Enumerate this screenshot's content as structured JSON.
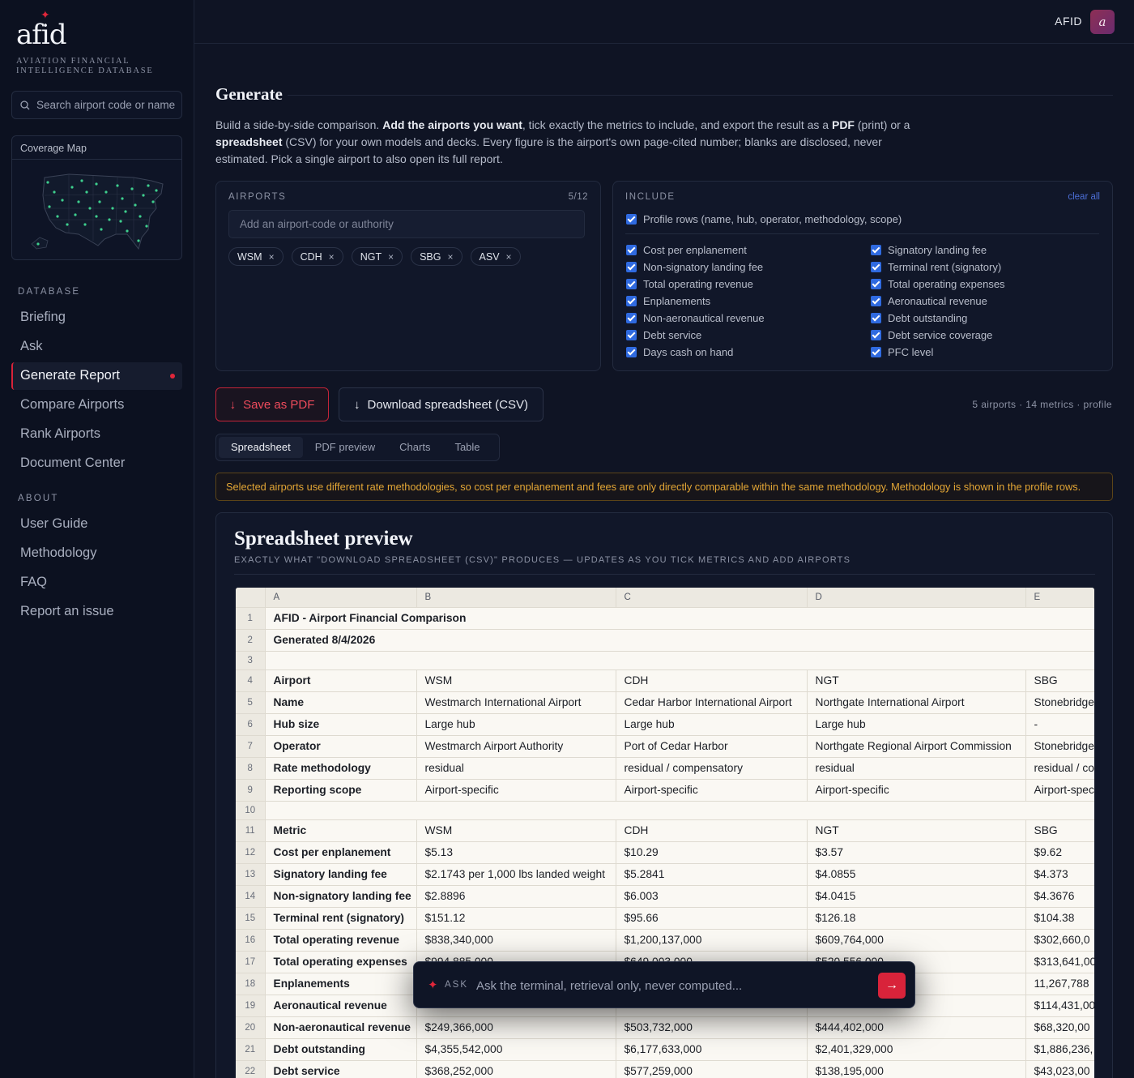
{
  "app": {
    "logo": "afid",
    "subtitle": "AVIATION FINANCIAL INTELLIGENCE DATABASE",
    "search_placeholder": "Search airport code or name",
    "coverage_map_label": "Coverage Map"
  },
  "nav": {
    "database_label": "DATABASE",
    "database_items": [
      "Briefing",
      "Ask",
      "Generate Report",
      "Compare Airports",
      "Rank Airports",
      "Document Center"
    ],
    "about_label": "ABOUT",
    "about_items": [
      "User Guide",
      "Methodology",
      "FAQ",
      "Report an issue"
    ]
  },
  "header": {
    "user": "AFID",
    "avatar": "a"
  },
  "generate": {
    "title": "Generate",
    "desc_1": "Build a side-by-side comparison. ",
    "desc_b1": "Add the airports you want",
    "desc_2": ", tick exactly the metrics to include, and export the result as a ",
    "desc_b2": "PDF",
    "desc_3": " (print) or a ",
    "desc_b3": "spreadsheet",
    "desc_4": " (CSV) for your own models and decks. Every figure is the airport's own page-cited number; blanks are disclosed, never estimated. Pick a single airport to also open its full report."
  },
  "airports": {
    "label": "AIRPORTS",
    "count": "5/12",
    "input_placeholder": "Add an airport-code or authority",
    "chips": [
      "WSM",
      "CDH",
      "NGT",
      "SBG",
      "ASV"
    ],
    "remove_glyph": "×"
  },
  "include": {
    "label": "INCLUDE",
    "clear_all": "clear all",
    "profile_rows": "Profile rows (name, hub, operator, methodology, scope)",
    "left_metrics": [
      "Cost per enplanement",
      "Non-signatory landing fee",
      "Total operating revenue",
      "Enplanements",
      "Non-aeronautical revenue",
      "Debt service",
      "Days cash on hand"
    ],
    "right_metrics": [
      "Signatory landing fee",
      "Terminal rent (signatory)",
      "Total operating expenses",
      "Aeronautical revenue",
      "Debt outstanding",
      "Debt service coverage",
      "PFC level"
    ]
  },
  "actions": {
    "pdf": "Save as PDF",
    "csv": "Download spreadsheet (CSV)",
    "download_glyph": "↓",
    "summary": "5 airports · 14 metrics · profile"
  },
  "tabs": [
    "Spreadsheet",
    "PDF preview",
    "Charts",
    "Table"
  ],
  "warning": "Selected airports use different rate methodologies, so cost per enplanement and fees are only directly comparable within the same methodology. Methodology is shown in the profile rows.",
  "preview": {
    "title": "Spreadsheet preview",
    "subtitle": "EXACTLY WHAT \"DOWNLOAD SPREADSHEET (CSV)\" PRODUCES — UPDATES AS YOU TICK METRICS AND ADD AIRPORTS"
  },
  "sheet": {
    "columns": [
      "A",
      "B",
      "C",
      "D",
      "E"
    ],
    "rows": [
      {
        "n": "1",
        "cells": [
          "AFID - Airport Financial Comparison"
        ]
      },
      {
        "n": "2",
        "cells": [
          "Generated 8/4/2026"
        ]
      },
      {
        "n": "3",
        "cells": []
      },
      {
        "n": "4",
        "cells": [
          "Airport",
          "WSM",
          "CDH",
          "NGT",
          "SBG"
        ]
      },
      {
        "n": "5",
        "cells": [
          "Name",
          "Westmarch International Airport",
          "Cedar Harbor International Airport",
          "Northgate International Airport",
          "Stonebridge"
        ]
      },
      {
        "n": "6",
        "cells": [
          "Hub size",
          "Large hub",
          "Large hub",
          "Large hub",
          "-"
        ]
      },
      {
        "n": "7",
        "cells": [
          "Operator",
          "Westmarch Airport Authority",
          "Port of Cedar Harbor",
          "Northgate Regional Airport Commission",
          "Stonebridge"
        ]
      },
      {
        "n": "8",
        "cells": [
          "Rate methodology",
          "residual",
          "residual / compensatory",
          "residual",
          "residual / co"
        ]
      },
      {
        "n": "9",
        "cells": [
          "Reporting scope",
          "Airport-specific",
          "Airport-specific",
          "Airport-specific",
          "Airport-spec"
        ]
      },
      {
        "n": "10",
        "cells": []
      },
      {
        "n": "11",
        "cells": [
          "Metric",
          "WSM",
          "CDH",
          "NGT",
          "SBG"
        ]
      },
      {
        "n": "12",
        "cells": [
          "Cost per enplanement",
          "$5.13",
          "$10.29",
          "$3.57",
          "$9.62"
        ]
      },
      {
        "n": "13",
        "cells": [
          "Signatory landing fee",
          "$2.1743 per 1,000 lbs landed weight",
          "$5.2841",
          "$4.0855",
          "$4.373"
        ]
      },
      {
        "n": "14",
        "cells": [
          "Non-signatory landing fee",
          "$2.8896",
          "$6.003",
          "$4.0415",
          "$4.3676"
        ]
      },
      {
        "n": "15",
        "cells": [
          "Terminal rent (signatory)",
          "$151.12",
          "$95.66",
          "$126.18",
          "$104.38"
        ]
      },
      {
        "n": "16",
        "cells": [
          "Total operating revenue",
          "$838,340,000",
          "$1,200,137,000",
          "$609,764,000",
          "$302,660,0"
        ]
      },
      {
        "n": "17",
        "cells": [
          "Total operating expenses",
          "$994,885,000",
          "$649,003,000",
          "$520,556,000",
          "$313,641,00"
        ]
      },
      {
        "n": "18",
        "cells": [
          "Enplanements",
          "",
          "",
          "",
          "11,267,788"
        ]
      },
      {
        "n": "19",
        "cells": [
          "Aeronautical revenue",
          "",
          "",
          "",
          "$114,431,00"
        ]
      },
      {
        "n": "20",
        "cells": [
          "Non-aeronautical revenue",
          "$249,366,000",
          "$503,732,000",
          "$444,402,000",
          "$68,320,00"
        ]
      },
      {
        "n": "21",
        "cells": [
          "Debt outstanding",
          "$4,355,542,000",
          "$6,177,633,000",
          "$2,401,329,000",
          "$1,886,236,"
        ]
      },
      {
        "n": "22",
        "cells": [
          "Debt service",
          "$368,252,000",
          "$577,259,000",
          "$138,195,000",
          "$43,023,00"
        ]
      }
    ]
  },
  "ask": {
    "label": "ASK",
    "placeholder": "Ask the terminal, retrieval only, never computed...",
    "submit_glyph": "→"
  },
  "colors": {
    "accent": "#d8233a",
    "bg": "#0f1424",
    "warn": "#e3a635",
    "check": "#2f6ae0"
  }
}
